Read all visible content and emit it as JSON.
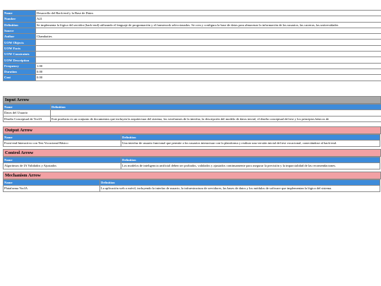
{
  "main": {
    "rows": [
      {
        "label": "Name",
        "value": "Desarrollo del  Back-end y la  Base de Datos"
      },
      {
        "label": "Number",
        "value": "A21"
      },
      {
        "label": "Definition",
        "value": "Se implementa la lógica del servidor (back-end) utilizando el lenguaje de programación y el framework seleccionados. Se crea y configura la base de datos para almacenar la información de los usuarios, las carreras, las universidades"
      },
      {
        "label": "Source",
        "value": ""
      },
      {
        "label": "Author",
        "value": "Chambaites"
      },
      {
        "label": "UOW Objects",
        "value": ""
      },
      {
        "label": "UOW Facts",
        "value": ""
      },
      {
        "label": "UOW Constraints",
        "value": ""
      },
      {
        "label": "UOW Description",
        "value": ""
      },
      {
        "label": "Frequency",
        "value": "1.00"
      },
      {
        "label": "Duration",
        "value": "0.00"
      },
      {
        "label": "Cost",
        "value": "0.00"
      }
    ]
  },
  "input": {
    "title": "Input Arrow",
    "col_name": "Name",
    "col_def": "Definition",
    "rows": [
      {
        "name": "Datos del Usuario",
        "def": ""
      },
      {
        "name": "Diseño Conceptual de VocIA",
        "def": "Este producto es un conjunto de documentos que incluyen la arquitectura del sistema, los wireframes de la interfaz, la descripción del modelo de datos inicial, el diseño conceptual del test y los principios básicos de"
      }
    ]
  },
  "output": {
    "title": "Output Arrow",
    "col_name": "Name",
    "col_def": "Definition",
    "rows": [
      {
        "name": "Front-end Interactivo con Test Vocacional Básico",
        "def": "Una interfaz de usuario funcional que permite a los usuarios interactuar con la plataforma y realizar una versión inicial del test vocacional, conectándose al back-end."
      }
    ]
  },
  "control": {
    "title": "Control Arrow",
    "col_name": "Name",
    "col_def": "Definition",
    "rows": [
      {
        "name": "Algoritmos de IA Validados y Ajustados",
        "def": "Los modelos de inteligencia artificial deben ser probados, validados y ajustados continuamente para asegurar la precisión y la imparcialidad de las recomendaciones."
      }
    ]
  },
  "mechanism": {
    "title": "Mechanism Arrow",
    "col_name": "Name",
    "col_def": "Definition",
    "rows": [
      {
        "name": "Plataforma VocIA",
        "def": "La aplicación web o móvil, incluyendo la interfaz de usuario, la infraestructura de servidores, las bases de datos y los módulos de software que implementan la lógica del sistema."
      }
    ]
  }
}
